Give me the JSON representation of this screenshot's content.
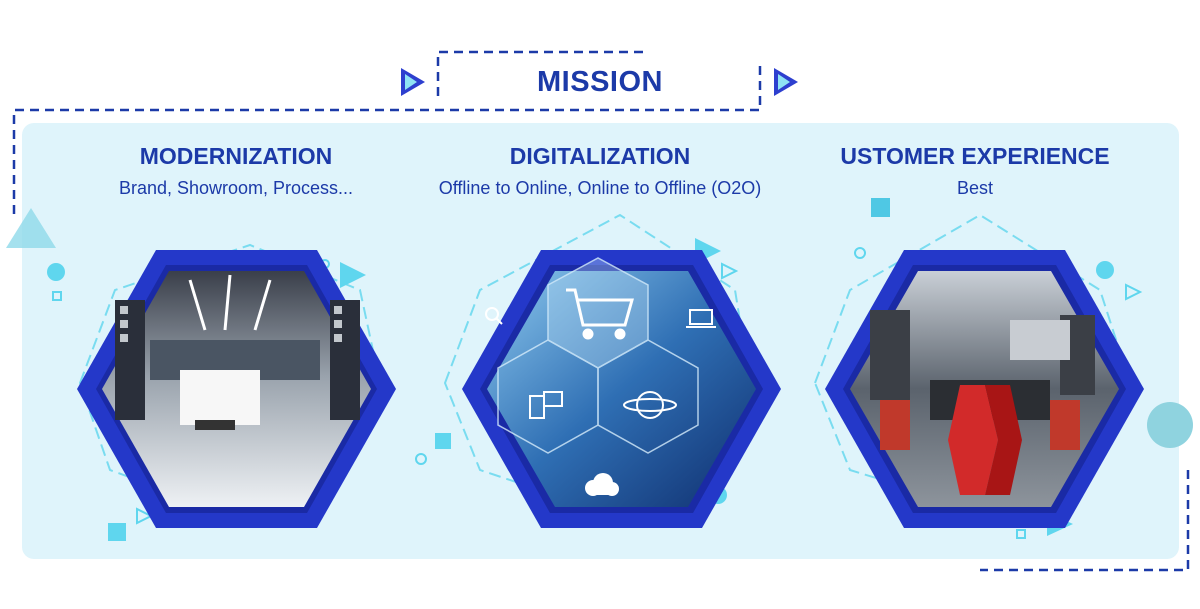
{
  "mission": {
    "title": "MISSION"
  },
  "pillars": [
    {
      "heading": "MODERNIZATION",
      "subheading": "Brand, Showroom, Process...",
      "image": "electronics-showroom-photo"
    },
    {
      "heading": "DIGITALIZATION",
      "subheading": "Offline to Online, Online to Offline (O2O)",
      "image": "digital-shopping-cart-photo"
    },
    {
      "heading": "USTOMER EXPERIENCE",
      "subheading": "Best",
      "image": "gaming-room-photo"
    }
  ],
  "colors": {
    "primary": "#1c3aa8",
    "accent": "#2d3fcf",
    "cyan": "#41d1ec",
    "panel": "#dff4fb"
  },
  "icons": [
    "play-arrow-icon",
    "shopping-cart-icon",
    "cloud-upload-icon",
    "globe-icon",
    "mobile-devices-icon",
    "laptop-icon",
    "search-icon"
  ]
}
